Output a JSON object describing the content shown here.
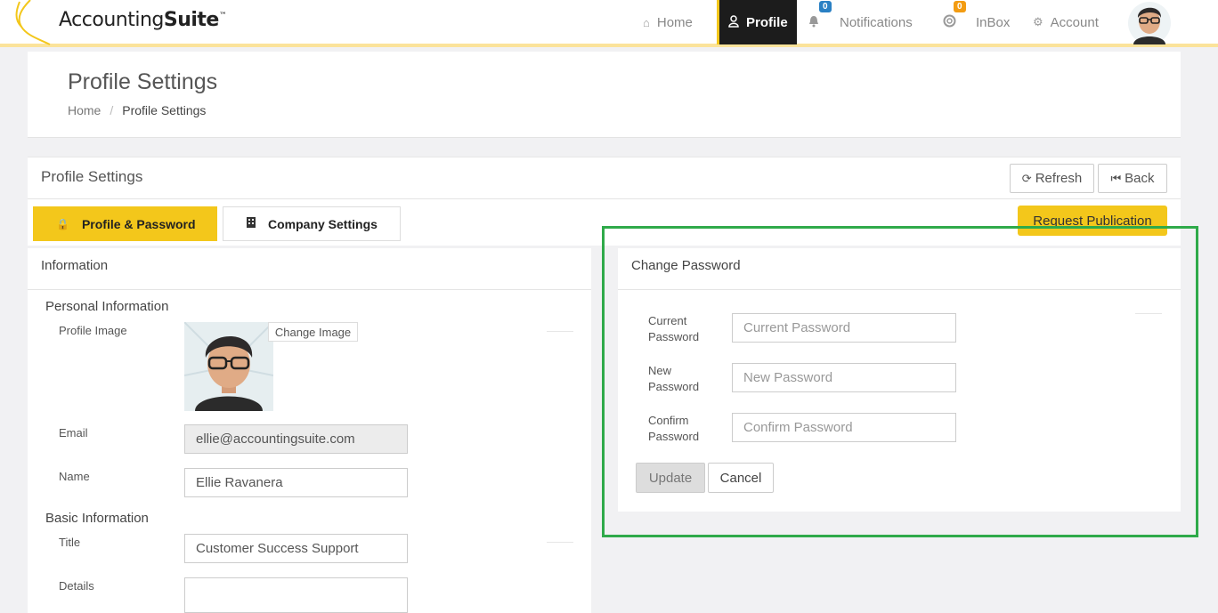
{
  "brand": {
    "name_regular": "Accounting",
    "name_bold": "Suite",
    "trademark": "™"
  },
  "nav": {
    "home": "Home",
    "profile": "Profile",
    "notifications": "Notifications",
    "notifications_count": "0",
    "inbox": "InBox",
    "inbox_count": "0",
    "account": "Account"
  },
  "header": {
    "title": "Profile Settings",
    "breadcrumb": {
      "home": "Home",
      "current": "Profile Settings"
    }
  },
  "card": {
    "title": "Profile Settings",
    "refresh": "Refresh",
    "back": "Back",
    "tabs": {
      "profile_password": "Profile & Password",
      "company_settings": "Company Settings"
    },
    "request_publication": "Request Publication"
  },
  "information": {
    "heading": "Information",
    "personal_heading": "Personal Information",
    "profile_image_label": "Profile Image",
    "change_image": "Change Image",
    "email_label": "Email",
    "email_value": "ellie@accountingsuite.com",
    "name_label": "Name",
    "name_value": "Ellie Ravanera",
    "basic_heading": "Basic Information",
    "title_label": "Title",
    "title_value": "Customer Success Support",
    "details_label": "Details",
    "details_value": ""
  },
  "password": {
    "heading": "Change Password",
    "current_label_1": "Current",
    "current_label_2": "Password",
    "current_placeholder": "Current Password",
    "new_label_1": "New",
    "new_label_2": "Password",
    "new_placeholder": "New Password",
    "confirm_label_1": "Confirm",
    "confirm_label_2": "Password",
    "confirm_placeholder": "Confirm Password",
    "update": "Update",
    "cancel": "Cancel"
  },
  "colors": {
    "accent": "#f3c71b",
    "dark": "#1c1c1c",
    "highlight": "#2faa4a",
    "badge_blue": "#2980c4",
    "badge_orange": "#f39c12"
  }
}
